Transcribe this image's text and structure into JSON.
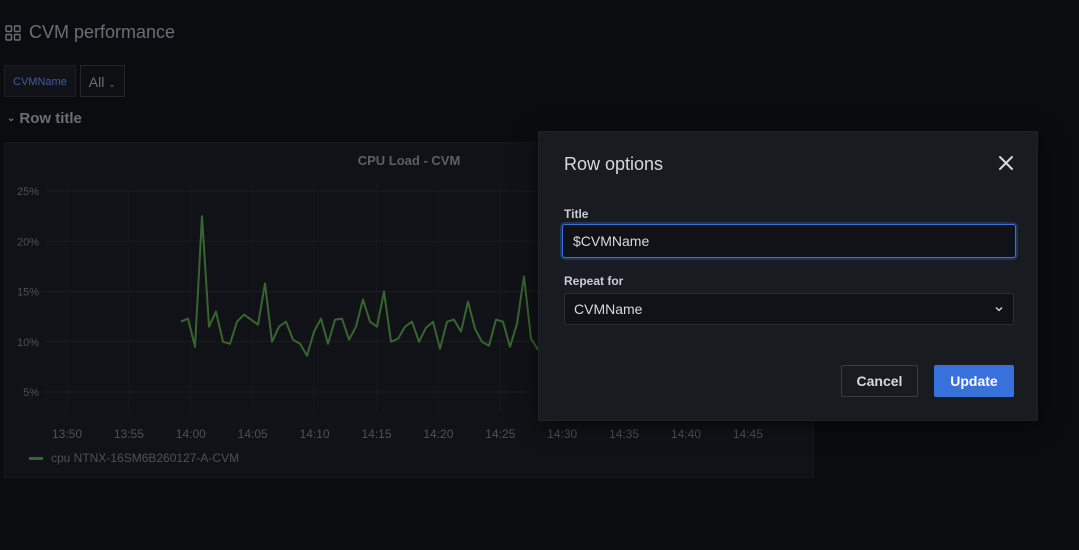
{
  "dashboard": {
    "title": "CVM performance",
    "variable": {
      "label": "CVMName",
      "value": "All"
    },
    "row_title": "Row title"
  },
  "panel": {
    "title": "CPU Load - CVM",
    "legend": "cpu NTNX-16SM6B260127-A-CVM",
    "series_color": "#37652f"
  },
  "chart_data": {
    "type": "line",
    "title": "CPU Load - CVM",
    "y_ticks": [
      "25%",
      "20%",
      "15%",
      "10%",
      "5%"
    ],
    "x_ticks": [
      "13:50",
      "13:55",
      "14:00",
      "14:05",
      "14:10",
      "14:15",
      "14:20",
      "14:25",
      "14:30",
      "14:35",
      "14:40",
      "14:45"
    ],
    "ylim": [
      3,
      26
    ],
    "grid": true,
    "legend_placement": "bottom-left",
    "series": [
      {
        "name": "cpu NTNX-16SM6B260127-A-CVM",
        "values": [
          12,
          12.3,
          9.5,
          22.5,
          11.5,
          13,
          10,
          9.8,
          12,
          12.7,
          12.2,
          11.7,
          15.8,
          10,
          11.5,
          12,
          10.2,
          9.8,
          8.6,
          11,
          12.3,
          9.8,
          12.2,
          12.3,
          10.2,
          11.5,
          14.2,
          12,
          11.5,
          15,
          10,
          10.3,
          11.5,
          12,
          10,
          11.4,
          12,
          9.3,
          12,
          12.2,
          11,
          14,
          11.3,
          10,
          9.6,
          12.2,
          12,
          9.5,
          11.8,
          16.5,
          10.3,
          9.2,
          12.2
        ]
      }
    ]
  },
  "modal": {
    "title": "Row options",
    "title_label": "Title",
    "title_value": "$CVMName",
    "repeat_label": "Repeat for",
    "repeat_value": "CVMName",
    "cancel_label": "Cancel",
    "update_label": "Update"
  }
}
